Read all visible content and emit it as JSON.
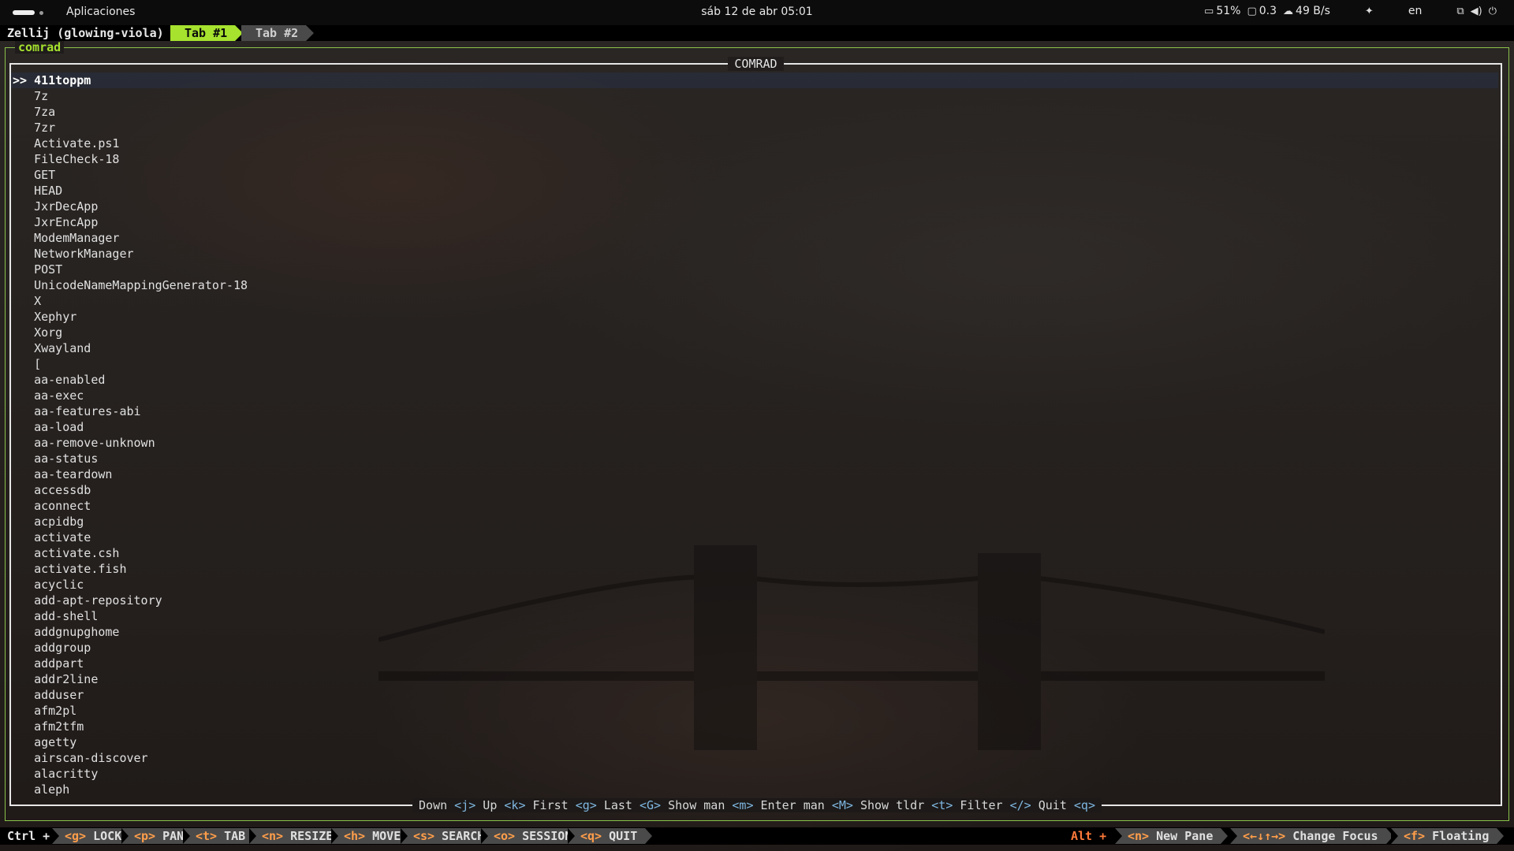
{
  "topbar": {
    "apps_label": "Aplicaciones",
    "clock": "sáb 12 de abr  05:01",
    "battery": "51%",
    "load": "0.3",
    "net": "49 B/s",
    "lang": "en"
  },
  "zellij": {
    "session": "Zellij (glowing-viola)",
    "tabs": [
      "Tab #1",
      "Tab #2"
    ],
    "pane_title": "comrad"
  },
  "app": {
    "title": "COMRAD",
    "prefix": ">>",
    "items": [
      "411toppm",
      "7z",
      "7za",
      "7zr",
      "Activate.ps1",
      "FileCheck-18",
      "GET",
      "HEAD",
      "JxrDecApp",
      "JxrEncApp",
      "ModemManager",
      "NetworkManager",
      "POST",
      "UnicodeNameMappingGenerator-18",
      "X",
      "Xephyr",
      "Xorg",
      "Xwayland",
      "[",
      "aa-enabled",
      "aa-exec",
      "aa-features-abi",
      "aa-load",
      "aa-remove-unknown",
      "aa-status",
      "aa-teardown",
      "accessdb",
      "aconnect",
      "acpidbg",
      "activate",
      "activate.csh",
      "activate.fish",
      "acyclic",
      "add-apt-repository",
      "add-shell",
      "addgnupghome",
      "addgroup",
      "addpart",
      "addr2line",
      "adduser",
      "afm2pl",
      "afm2tfm",
      "agetty",
      "airscan-discover",
      "alacritty",
      "aleph"
    ],
    "help": [
      {
        "label": "Down",
        "key": "<j>"
      },
      {
        "label": "Up",
        "key": "<k>"
      },
      {
        "label": "First",
        "key": "<g>"
      },
      {
        "label": "Last",
        "key": "<G>"
      },
      {
        "label": "Show man",
        "key": "<m>"
      },
      {
        "label": "Enter man",
        "key": "<M>"
      },
      {
        "label": "Show tldr",
        "key": "<t>"
      },
      {
        "label": "Filter",
        "key": "</>"
      },
      {
        "label": "Quit",
        "key": "<q>"
      }
    ]
  },
  "statusbar": {
    "ctrl": "Ctrl +",
    "modes": [
      {
        "key": "<g>",
        "label": "LOCK"
      },
      {
        "key": "<p>",
        "label": "PANE"
      },
      {
        "key": "<t>",
        "label": "TAB"
      },
      {
        "key": "<n>",
        "label": "RESIZE"
      },
      {
        "key": "<h>",
        "label": "MOVE"
      },
      {
        "key": "<s>",
        "label": "SEARCH"
      },
      {
        "key": "<o>",
        "label": "SESSION"
      },
      {
        "key": "<q>",
        "label": "QUIT"
      }
    ],
    "alt": "Alt +",
    "alt_items": [
      {
        "key": "<n>",
        "label": "New Pane"
      },
      {
        "key": "<←↓↑→>",
        "label": "Change Focus"
      },
      {
        "key": "<f>",
        "label": "Floating"
      }
    ]
  }
}
